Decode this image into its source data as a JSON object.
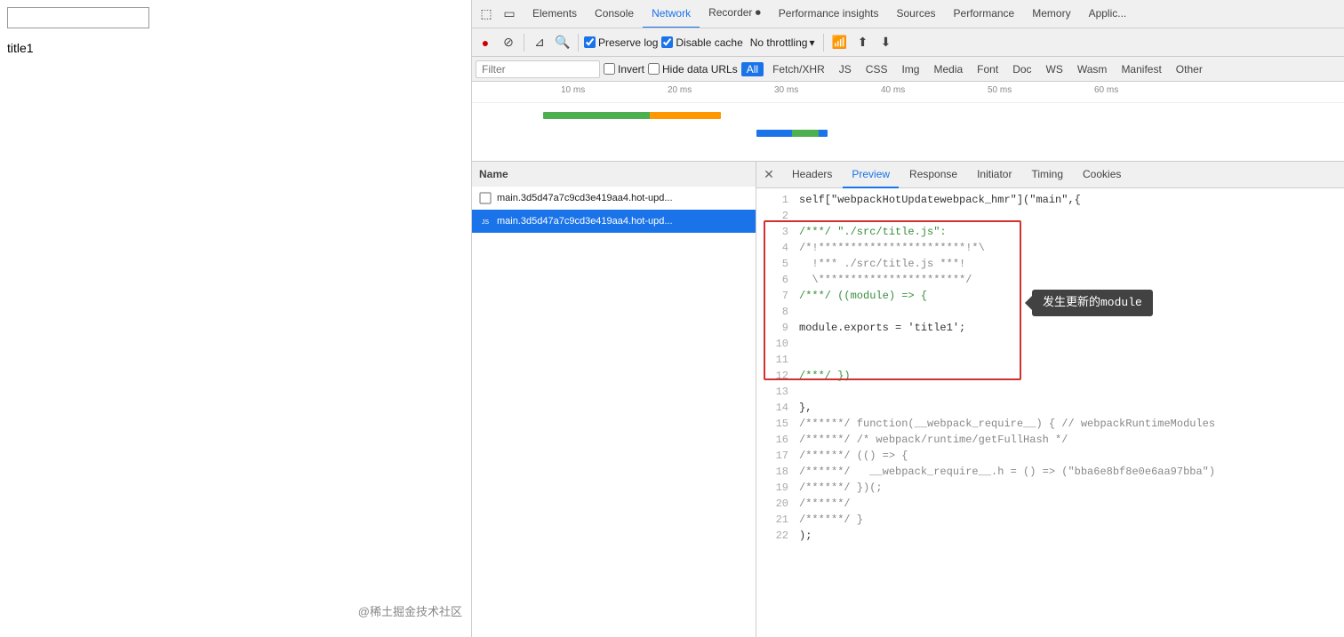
{
  "page": {
    "input_value": "",
    "title": "title1"
  },
  "watermark": "@稀土掘金技术社区",
  "devtools": {
    "tabs": [
      {
        "id": "elements",
        "label": "Elements",
        "active": false
      },
      {
        "id": "console",
        "label": "Console",
        "active": false
      },
      {
        "id": "network",
        "label": "Network",
        "active": true
      },
      {
        "id": "recorder",
        "label": "Recorder 🎙",
        "active": false
      },
      {
        "id": "performance-insights",
        "label": "Performance insights",
        "active": false
      },
      {
        "id": "sources",
        "label": "Sources",
        "active": false
      },
      {
        "id": "performance",
        "label": "Performance",
        "active": false
      },
      {
        "id": "memory",
        "label": "Memory",
        "active": false
      },
      {
        "id": "application",
        "label": "Applic...",
        "active": false
      }
    ],
    "toolbar": {
      "preserve_log_label": "Preserve log",
      "disable_cache_label": "Disable cache",
      "throttling_label": "No throttling"
    },
    "filter": {
      "placeholder": "Filter",
      "invert_label": "Invert",
      "hide_data_urls_label": "Hide data URLs",
      "type_buttons": [
        "All",
        "Fetch/XHR",
        "JS",
        "CSS",
        "Img",
        "Media",
        "Font",
        "Doc",
        "WS",
        "Wasm",
        "Manifest",
        "Other"
      ]
    },
    "timeline": {
      "marks": [
        "10 ms",
        "20 ms",
        "30 ms",
        "40 ms",
        "50 ms",
        "60 ms"
      ]
    },
    "files_header": "Name",
    "files": [
      {
        "id": 1,
        "name": "main.3d5d47a7c9cd3e419aa4.hot-upd...",
        "selected": false,
        "type": "doc"
      },
      {
        "id": 2,
        "name": "main.3d5d47a7c9cd3e419aa4.hot-upd...",
        "selected": true,
        "type": "js"
      }
    ],
    "preview_tabs": [
      "Headers",
      "Preview",
      "Response",
      "Initiator",
      "Timing",
      "Cookies"
    ],
    "active_preview_tab": "Preview",
    "code": {
      "lines": [
        {
          "n": 1,
          "text": "self[\"webpackHotUpdatewebpack_hmr\"](\"main\",{",
          "type": "normal"
        },
        {
          "n": 2,
          "text": "",
          "type": "normal"
        },
        {
          "n": 3,
          "text": "/***/ \"./src/title.js\":",
          "type": "comment-green"
        },
        {
          "n": 4,
          "text": "/*!***********************!*\\",
          "type": "comment"
        },
        {
          "n": 5,
          "text": "  !*** ./src/title.js ***!",
          "type": "comment"
        },
        {
          "n": 6,
          "text": "  \\***********************/",
          "type": "comment"
        },
        {
          "n": 7,
          "text": "/***/ ((module) => {",
          "type": "comment-green"
        },
        {
          "n": 8,
          "text": "",
          "type": "normal"
        },
        {
          "n": 9,
          "text": "module.exports = 'title1';",
          "type": "normal"
        },
        {
          "n": 10,
          "text": "",
          "type": "normal"
        },
        {
          "n": 11,
          "text": "",
          "type": "normal"
        },
        {
          "n": 12,
          "text": "/***/ })",
          "type": "comment-green"
        },
        {
          "n": 13,
          "text": "",
          "type": "normal"
        },
        {
          "n": 14,
          "text": "},",
          "type": "normal"
        },
        {
          "n": 15,
          "text": "/******/ function(__webpack_require__) { // webpackRuntimeModules",
          "type": "comment"
        },
        {
          "n": 16,
          "text": "/******/ /* webpack/runtime/getFullHash */",
          "type": "comment"
        },
        {
          "n": 17,
          "text": "/******/ (() => {",
          "type": "comment"
        },
        {
          "n": 18,
          "text": "/******/   __webpack_require__.h = () => (\"bba6e8bf8e0e6aa97bba\")",
          "type": "comment"
        },
        {
          "n": 19,
          "text": "/******/ })(;",
          "type": "comment"
        },
        {
          "n": 20,
          "text": "/******/",
          "type": "comment"
        },
        {
          "n": 21,
          "text": "/******/ }",
          "type": "comment"
        },
        {
          "n": 22,
          "text": ");",
          "type": "normal"
        }
      ]
    },
    "highlight_box": {
      "label": "发生更新的module"
    }
  }
}
